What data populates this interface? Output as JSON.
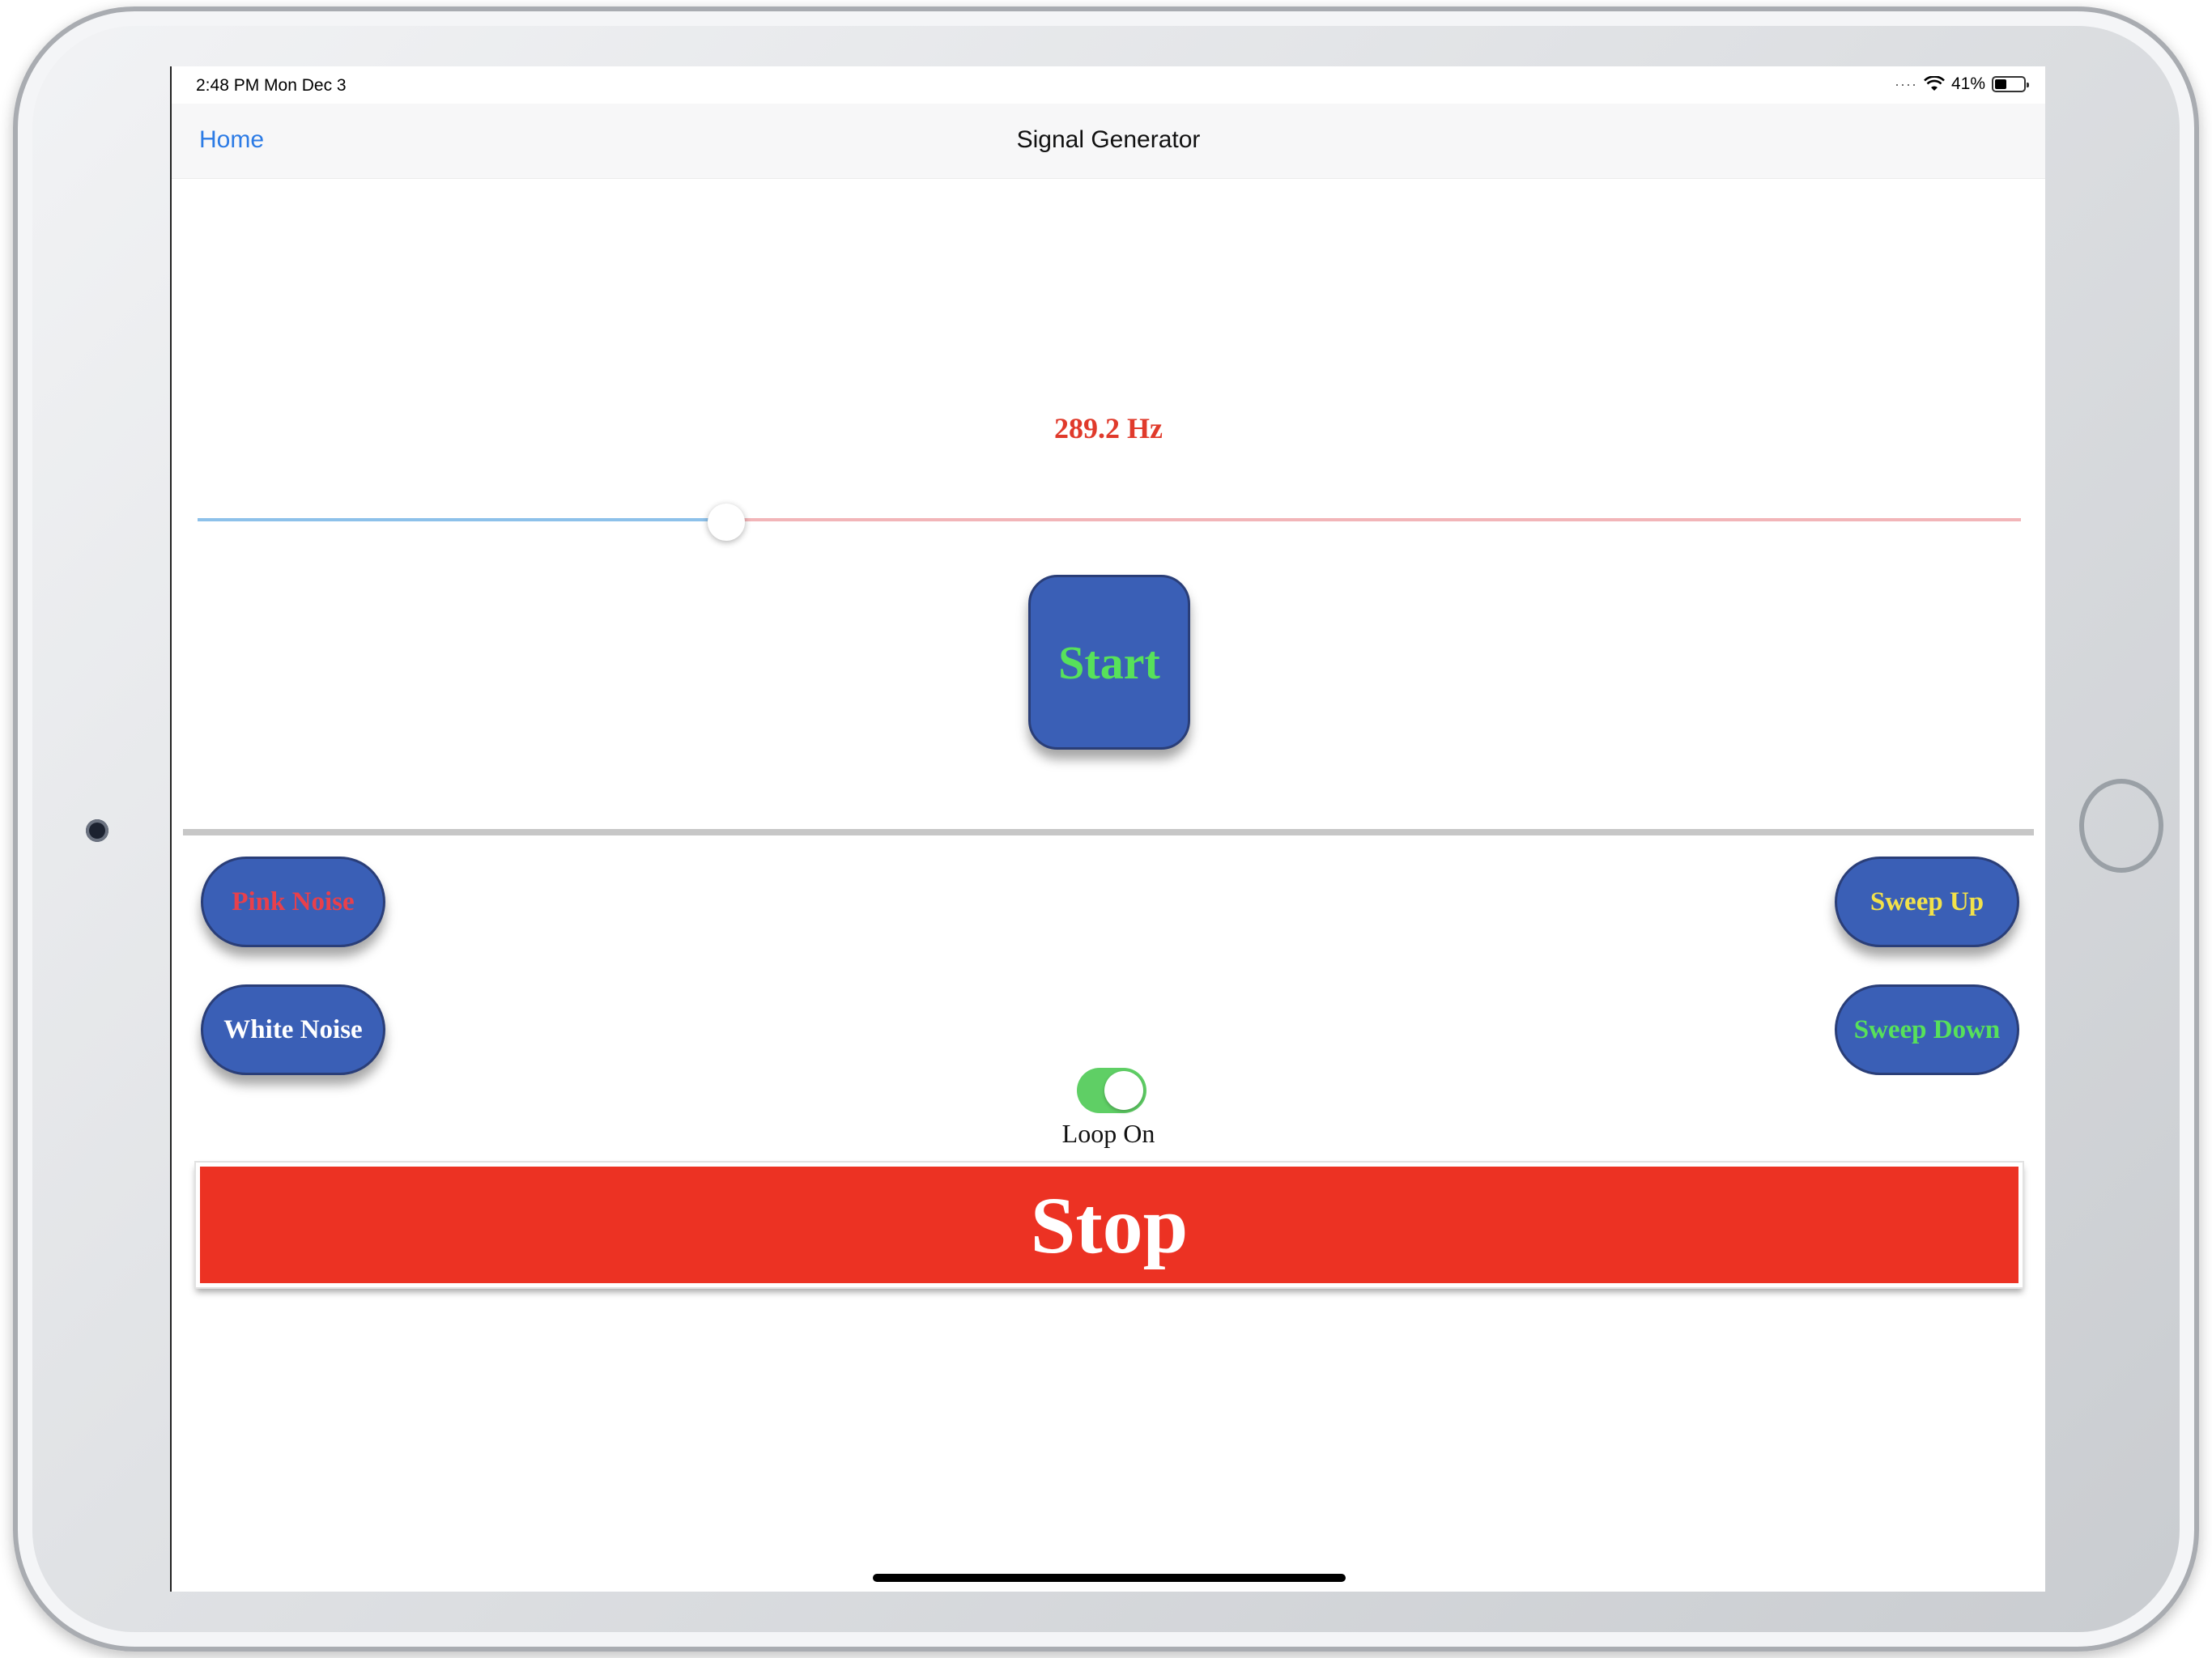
{
  "status_bar": {
    "time_date": "2:48 PM   Mon Dec 3",
    "battery_text": "41%"
  },
  "nav": {
    "back_label": "Home",
    "title": "Signal Generator"
  },
  "frequency": {
    "label": "289.2 Hz",
    "slider_fraction": 0.29
  },
  "buttons": {
    "start": "Start",
    "pink_noise": "Pink Noise",
    "white_noise": "White Noise",
    "sweep_up": "Sweep Up",
    "sweep_down": "Sweep Down",
    "stop": "Stop"
  },
  "loop": {
    "label": "Loop On",
    "enabled": true
  },
  "colors": {
    "accent_blue": "#3a5fb6",
    "start_text": "#57e15a",
    "pink_text": "#e8404b",
    "sweep_up_text": "#f2e24a",
    "stop_red": "#ec3223",
    "freq_red": "#e03a2b",
    "toggle_green": "#5fcf65"
  }
}
